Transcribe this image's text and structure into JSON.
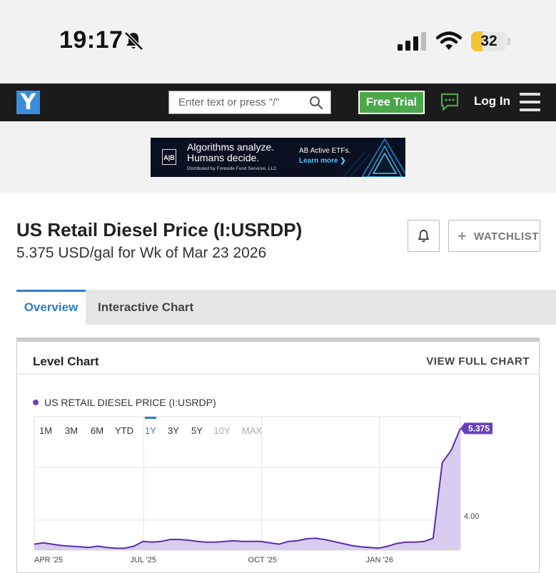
{
  "status_bar": {
    "time": "19:17",
    "battery": "32",
    "battery_level_percent": 32
  },
  "nav": {
    "logo": "Y",
    "search_placeholder": "Enter text or press \"/\"",
    "free_trial_label": "Free Trial",
    "login_label": "Log In"
  },
  "ad": {
    "logo_text": "A|B",
    "headline_1": "Algorithms analyze.",
    "headline_2": "Humans decide.",
    "distributed": "Distributed by Foreside Fund Services, LLC",
    "etf": "AB Active ETFs.",
    "learn": "Learn more ❯"
  },
  "page": {
    "title": "US Retail Diesel Price (I:USRDP)",
    "subtitle": "5.375 USD/gal for Wk of Mar 23 2026",
    "watchlist_label": "WATCHLIST"
  },
  "tabs": [
    {
      "label": "Overview",
      "active": true
    },
    {
      "label": "Interactive Chart",
      "active": false
    }
  ],
  "chart_card": {
    "title": "Level Chart",
    "view_full_label": "VIEW FULL CHART"
  },
  "chart_data": {
    "type": "area",
    "series": [
      {
        "name": "US RETAIL DIESEL PRICE (I:USRDP)",
        "values": [
          3.64,
          3.66,
          3.64,
          3.62,
          3.61,
          3.6,
          3.59,
          3.61,
          3.59,
          3.58,
          3.58,
          3.61,
          3.68,
          3.67,
          3.68,
          3.71,
          3.71,
          3.7,
          3.68,
          3.67,
          3.67,
          3.68,
          3.69,
          3.68,
          3.68,
          3.68,
          3.66,
          3.64,
          3.68,
          3.69,
          3.72,
          3.73,
          3.71,
          3.68,
          3.65,
          3.62,
          3.6,
          3.59,
          3.58,
          3.61,
          3.65,
          3.67,
          3.67,
          3.68,
          3.73,
          4.86,
          5.05,
          5.375
        ]
      }
    ],
    "x_tick_labels": [
      "APR '25",
      "JUL '25",
      "OCT '25",
      "JAN '26"
    ],
    "y_label_value": 4.0,
    "y_tick_label": "4.00",
    "last_value_label": "5.375",
    "ylim": [
      3.55,
      5.55
    ],
    "range_buttons": [
      "1M",
      "3M",
      "6M",
      "YTD",
      "1Y",
      "3Y",
      "5Y",
      "10Y",
      "MAX"
    ],
    "selected_range": "1Y",
    "disabled_ranges": [
      "10Y",
      "MAX"
    ],
    "grid": true,
    "colors": {
      "line": "#5a2dab",
      "fill": "#d8cdef",
      "accent": "#6a3fbf"
    }
  }
}
